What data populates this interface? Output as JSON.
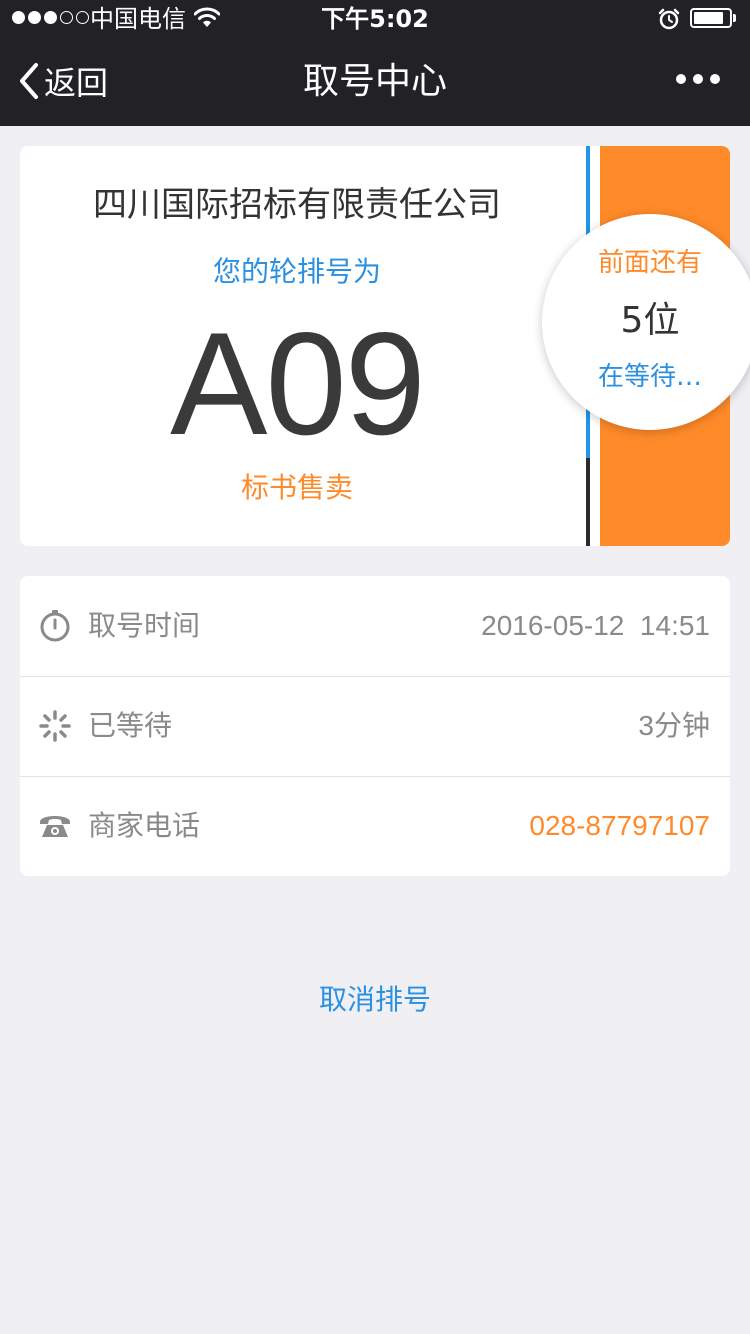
{
  "status_bar": {
    "carrier": "中国电信",
    "time": "下午5:02",
    "signal_bars": 3,
    "signal_max": 5,
    "battery_level": 0.85
  },
  "nav": {
    "back_label": "返回",
    "title": "取号中心",
    "more_icon": "more-dots-icon"
  },
  "ticket": {
    "company": "四川国际招标有限责任公司",
    "queue_label": "您的轮排号为",
    "number": "A09",
    "service": "标书售卖",
    "ahead_label": "前面还有",
    "ahead_count": "5位",
    "ahead_status": "在等待…",
    "progress": 0.78,
    "colors": {
      "accent_orange": "#ff8a29",
      "accent_blue": "#2b90e0"
    }
  },
  "info": {
    "rows": [
      {
        "icon": "stopwatch-icon",
        "label": "取号时间",
        "value": "2016-05-12  14:51"
      },
      {
        "icon": "spinner-icon",
        "label": "已等待",
        "value": "3分钟"
      },
      {
        "icon": "phone-icon",
        "label": "商家电话",
        "value": "028-87797107"
      }
    ]
  },
  "actions": {
    "cancel_label": "取消排号"
  }
}
